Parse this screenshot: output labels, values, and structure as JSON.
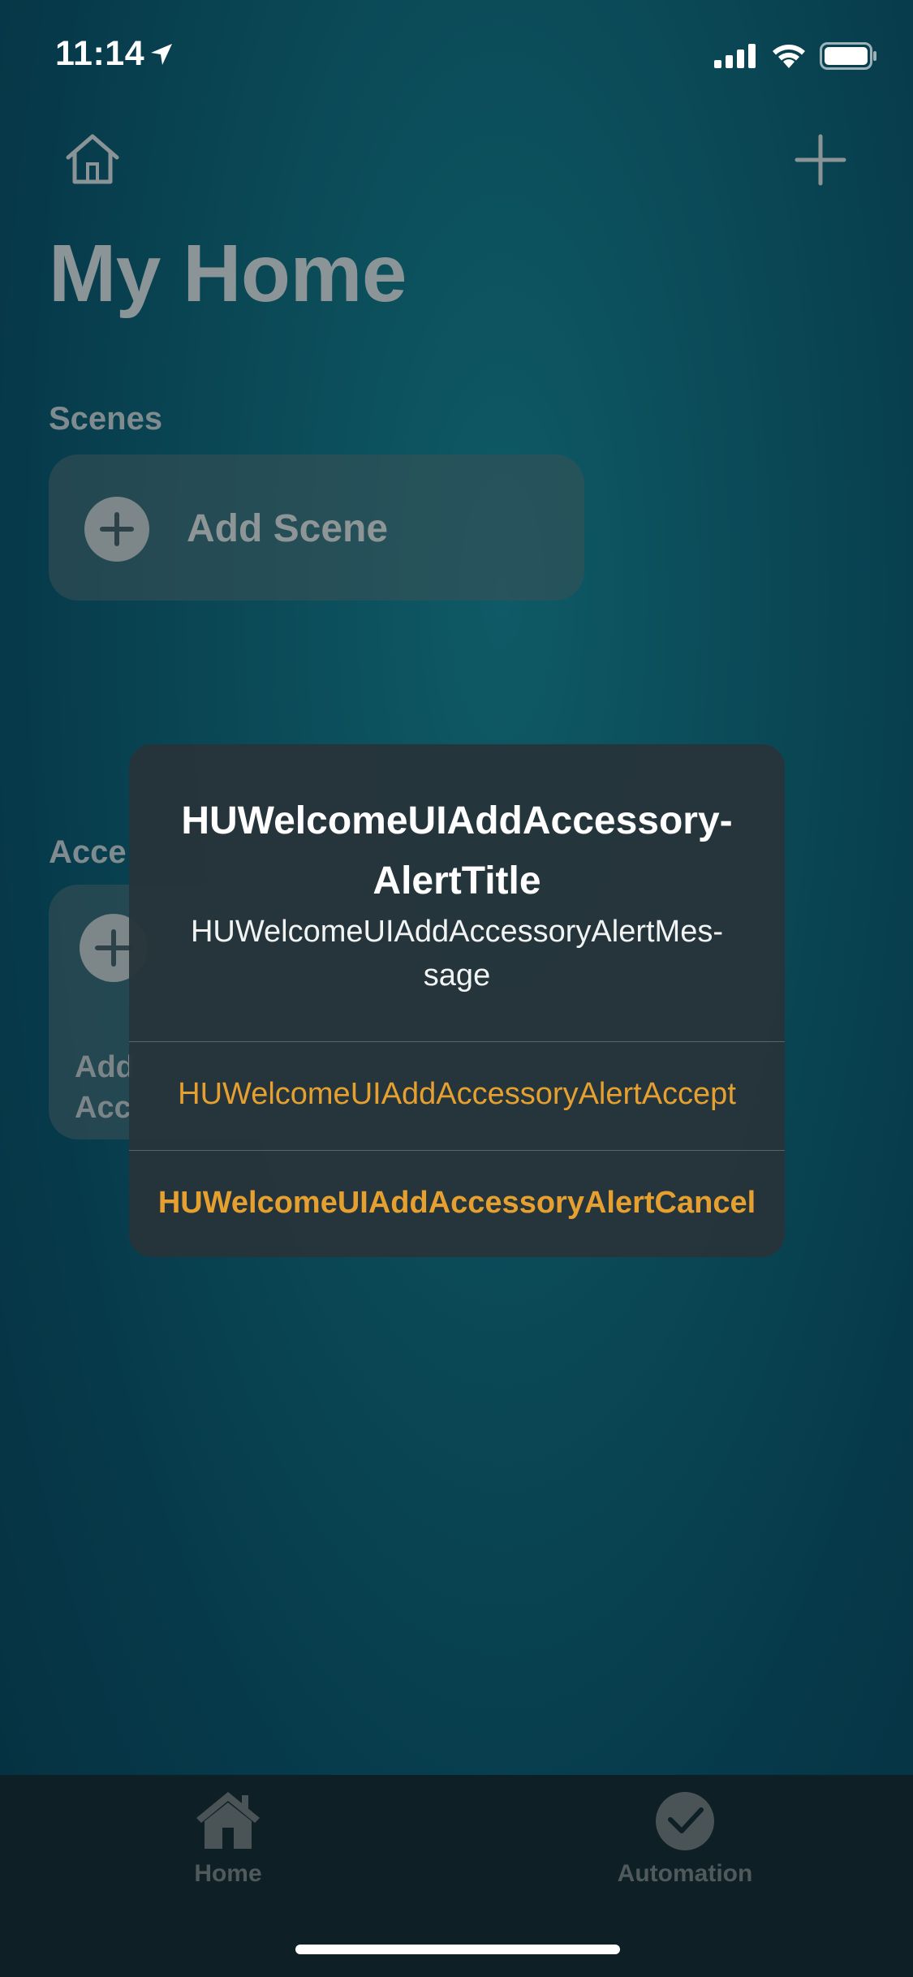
{
  "status_bar": {
    "time": "11:14"
  },
  "header": {
    "title": "My Home"
  },
  "scenes": {
    "label": "Scenes",
    "add_label": "Add Scene"
  },
  "accessories": {
    "label_visible": "Acce",
    "card_line1": "Add",
    "card_line2": "Acc"
  },
  "alert": {
    "title_line1": "HUWelcomeUIAddAccessory-",
    "title_line2": "AlertTitle",
    "message_line1": "HUWelcomeUIAddAccessoryAlertMes-",
    "message_line2": "sage",
    "accept_label": "HUWelcomeUIAddAccessoryAlertAccept",
    "cancel_label": "HUWelcomeUIAddAccessoryAlertCancel"
  },
  "tabbar": {
    "home_label": "Home",
    "automation_label": "Automation",
    "active_tab": "none-dimmed"
  },
  "colors": {
    "accent": "#e6a030",
    "alert_bg": "#26343a",
    "background": "#0b4a57",
    "tab_bg": "#0e1f26"
  },
  "icons": [
    "location-arrow-icon",
    "signal-icon",
    "wifi-icon",
    "battery-icon",
    "home-icon",
    "plus-icon",
    "plus-circle-icon",
    "house-tab-icon",
    "clock-check-icon"
  ]
}
